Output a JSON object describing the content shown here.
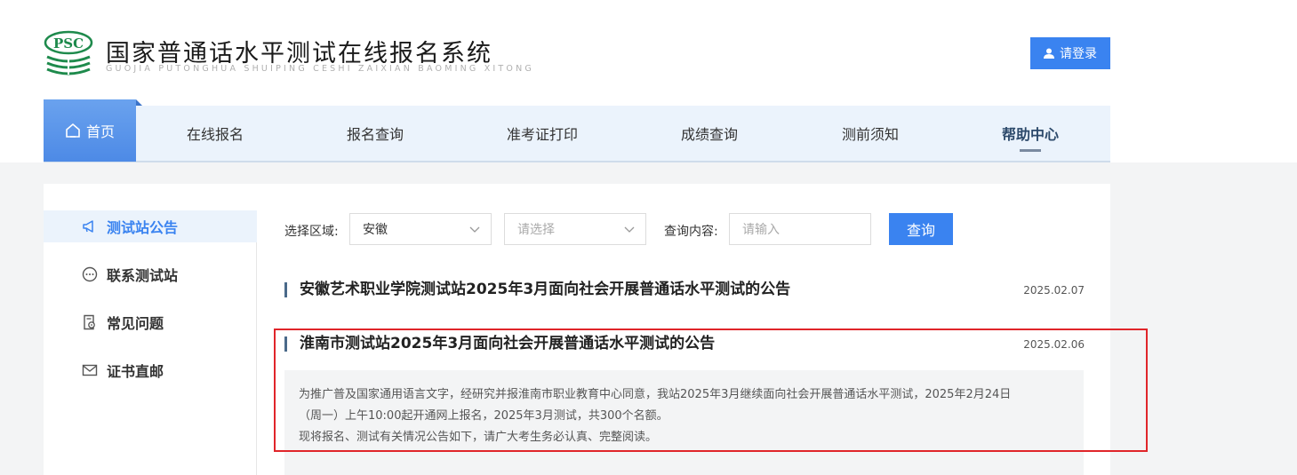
{
  "header": {
    "logo_text": "PSC",
    "title": "国家普通话水平测试在线报名系统",
    "subtitle": "GUOJIA PUTONGHUA SHUIPING CESHI ZAIXIAN BAOMING XITONG",
    "login_label": "请登录",
    "accent_color": "#3a83f0"
  },
  "nav": {
    "items": [
      {
        "label": "首页",
        "icon": "home-icon"
      },
      {
        "label": "在线报名"
      },
      {
        "label": "报名查询"
      },
      {
        "label": "准考证打印"
      },
      {
        "label": "成绩查询"
      },
      {
        "label": "测前须知"
      },
      {
        "label": "帮助中心"
      }
    ]
  },
  "sidebar": {
    "items": [
      {
        "label": "测试站公告",
        "icon": "megaphone-icon"
      },
      {
        "label": "联系测试站",
        "icon": "chat-icon"
      },
      {
        "label": "常见问题",
        "icon": "question-doc-icon"
      },
      {
        "label": "证书直邮",
        "icon": "mail-icon"
      }
    ]
  },
  "filter": {
    "region_label": "选择区域:",
    "region_value": "安徽",
    "station_placeholder": "请选择",
    "query_label": "查询内容:",
    "query_placeholder": "请输入",
    "query_button": "查询"
  },
  "notices": [
    {
      "title": "安徽艺术职业学院测试站2025年3月面向社会开展普通话水平测试的公告",
      "date": "2025.02.07"
    },
    {
      "title": "淮南市测试站2025年3月面向社会开展普通话水平测试的公告",
      "date": "2025.02.06",
      "summary_line1": "为推广普及国家通用语言文字，经研究并报淮南市职业教育中心同意，我站2025年3月继续面向社会开展普通话水平测试，2025年2月24日",
      "summary_line2": "（周一）上午10:00起开通网上报名，2025年3月测试，共300个名额。",
      "summary_line3": "现将报名、测试有关情况公告如下，请广大考生务必认真、完整阅读。"
    }
  ]
}
